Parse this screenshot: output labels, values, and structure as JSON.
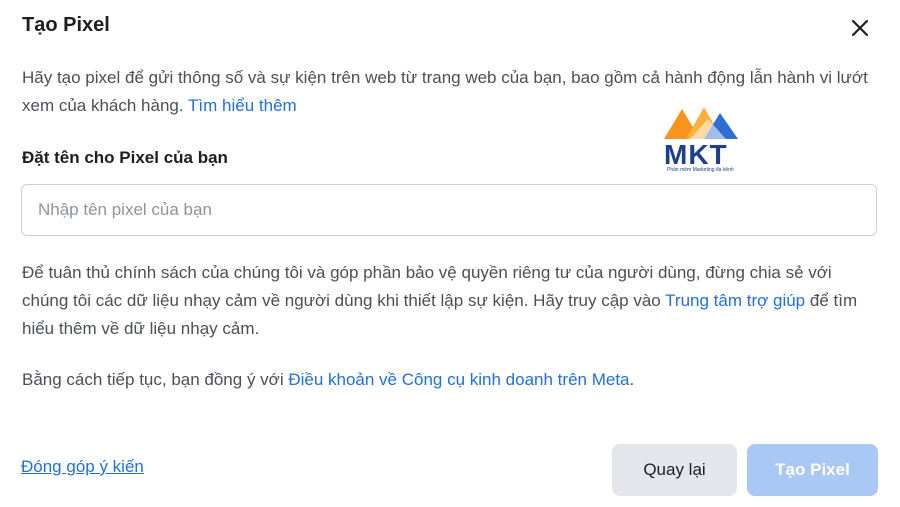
{
  "dialog": {
    "title": "Tạo Pixel",
    "intro_text": "Hãy tạo pixel để gửi thông số và sự kiện trên web từ trang web của bạn, bao gồm cả hành động lẫn hành vi lướt xem của khách hàng.",
    "intro_link": "Tìm hiểu thêm",
    "name_label": "Đặt tên cho Pixel của bạn",
    "name_input": {
      "value": "",
      "placeholder": "Nhập tên pixel của bạn"
    },
    "policy_text_1": "Để tuân thủ chính sách của chúng tôi và góp phần bảo vệ quyền riêng tư của người dùng, đừng chia sẻ với chúng tôi các dữ liệu nhạy cảm về người dùng khi thiết lập sự kiện. Hãy truy cập vào",
    "policy_link": "Trung tâm trợ giúp",
    "policy_text_2": "để tìm hiểu thêm về dữ liệu nhạy cảm.",
    "terms_text": "Bằng cách tiếp tục, bạn đồng ý với",
    "terms_link": "Điều khoản về Công cụ kinh doanh trên Meta",
    "terms_end": ".",
    "feedback_link": "Đóng góp ý kiến",
    "back_button": "Quay lại",
    "create_button": "Tạo Pixel"
  },
  "watermark": {
    "brand": "MKT",
    "tagline": "Phần mềm Marketing đa kênh"
  },
  "colors": {
    "link": "#216fdb",
    "primary_disabled": "#a9c8f5",
    "secondary_button": "#e4e6eb",
    "logo_orange": "#f7941d",
    "logo_blue": "#1d3f8c"
  },
  "icons": {
    "close": "close-icon"
  }
}
